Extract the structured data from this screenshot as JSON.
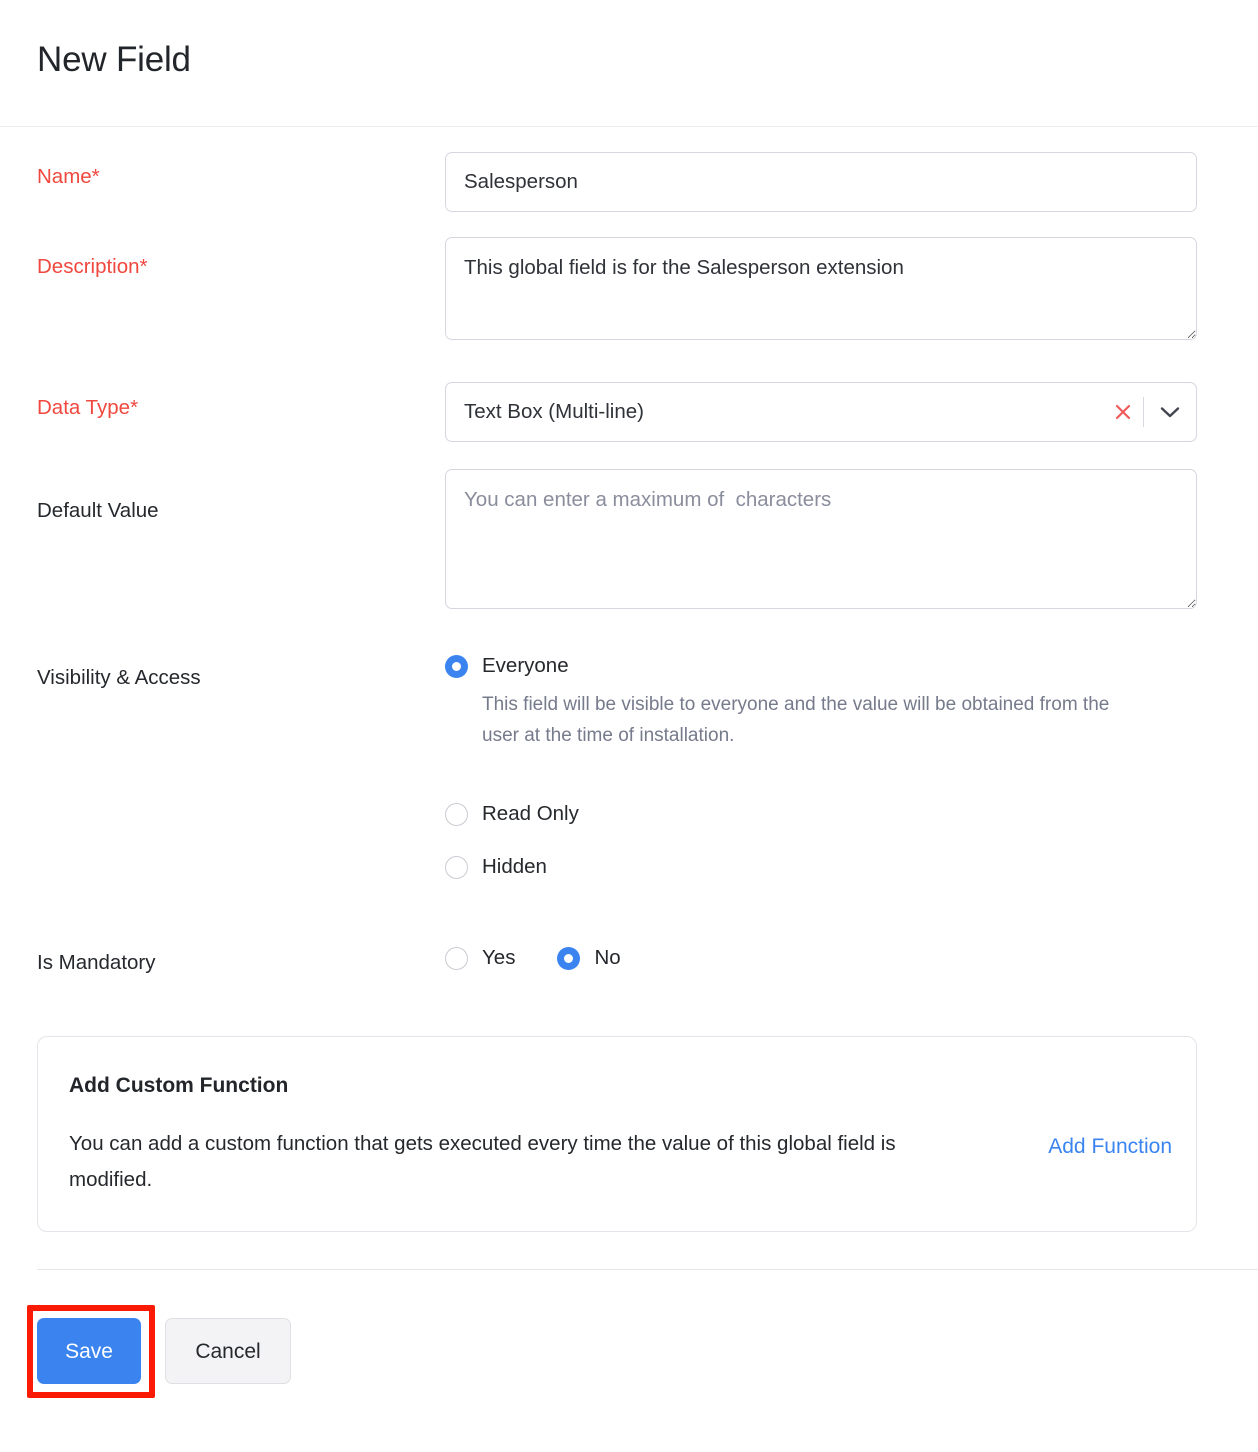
{
  "header": {
    "title": "New Field"
  },
  "form": {
    "name": {
      "label": "Name*",
      "value": "Salesperson",
      "placeholder": ""
    },
    "description": {
      "label": "Description*",
      "value": "This global field is for the Salesperson extension",
      "placeholder": ""
    },
    "data_type": {
      "label": "Data Type*",
      "value": "Text Box (Multi-line)",
      "clear_icon": "close-x-icon",
      "caret_icon": "chevron-down-icon"
    },
    "default_value": {
      "label": "Default Value",
      "value": "",
      "placeholder": "You can enter a maximum of  characters"
    },
    "visibility": {
      "label": "Visibility & Access",
      "options": [
        {
          "label": "Everyone",
          "selected": true,
          "hint": "This field will be visible to everyone and the value will be obtained from the user at the time of installation."
        },
        {
          "label": "Read Only",
          "selected": false,
          "hint": ""
        },
        {
          "label": "Hidden",
          "selected": false,
          "hint": ""
        }
      ]
    },
    "mandatory": {
      "label": "Is Mandatory",
      "options": [
        {
          "label": "Yes",
          "selected": false
        },
        {
          "label": "No",
          "selected": true
        }
      ]
    }
  },
  "custom_function": {
    "title": "Add Custom Function",
    "description": "You can add a custom function that gets executed every time the value of this global field is modified.",
    "link_label": "Add Function"
  },
  "footer": {
    "save_label": "Save",
    "cancel_label": "Cancel"
  },
  "colors": {
    "accent_blue": "#3b84f0",
    "required_red": "#f0483e",
    "clear_icon_red": "#f25b5b",
    "highlight_red": "#fb1b05",
    "hint_gray": "#767b8c"
  }
}
